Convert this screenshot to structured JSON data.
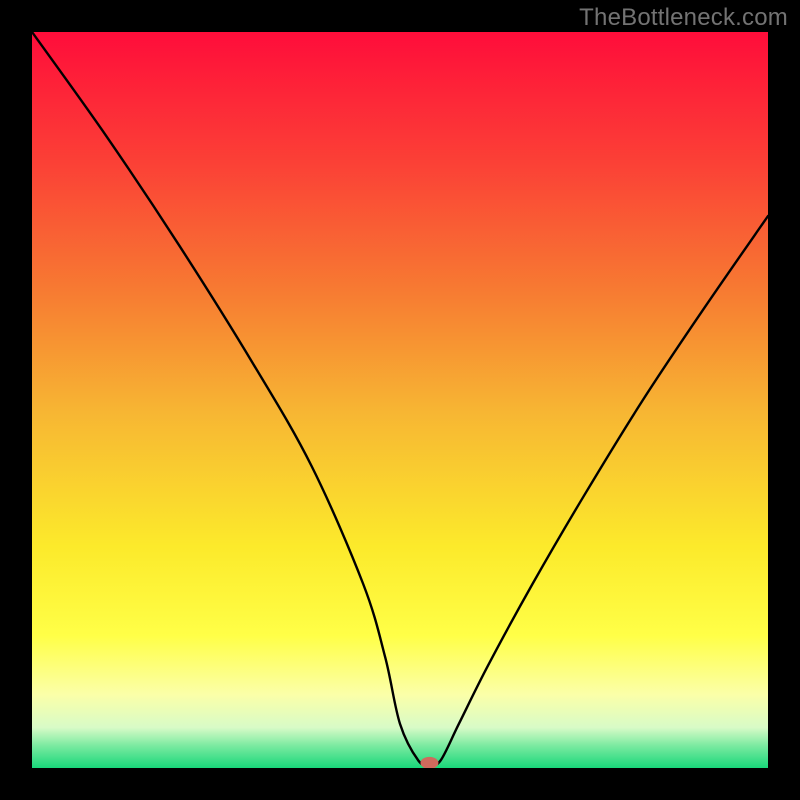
{
  "watermark": "TheBottleneck.com",
  "chart_data": {
    "type": "line",
    "title": "",
    "xlabel": "",
    "ylabel": "",
    "xlim": [
      0,
      100
    ],
    "ylim": [
      0,
      100
    ],
    "background": {
      "type": "vertical-gradient",
      "stops": [
        {
          "pos": 0.0,
          "color": "#ff0d3a"
        },
        {
          "pos": 0.18,
          "color": "#fb4136"
        },
        {
          "pos": 0.35,
          "color": "#f77a32"
        },
        {
          "pos": 0.52,
          "color": "#f7b733"
        },
        {
          "pos": 0.7,
          "color": "#fcea2b"
        },
        {
          "pos": 0.82,
          "color": "#ffff47"
        },
        {
          "pos": 0.9,
          "color": "#fbffa8"
        },
        {
          "pos": 0.945,
          "color": "#d8fbc7"
        },
        {
          "pos": 0.97,
          "color": "#7aeaa0"
        },
        {
          "pos": 1.0,
          "color": "#19d77a"
        }
      ]
    },
    "series": [
      {
        "name": "bottleneck-curve",
        "x": [
          0,
          10,
          20,
          30,
          38,
          45,
          48,
          50,
          52.5,
          54,
          55.5,
          58,
          62,
          68,
          75,
          83,
          91,
          100
        ],
        "y": [
          100,
          86,
          71,
          55,
          41,
          25,
          15,
          6,
          1,
          0.5,
          1,
          6,
          14,
          25,
          37,
          50,
          62,
          75
        ]
      }
    ],
    "marker": {
      "name": "optimal-point",
      "x": 54,
      "y": 0.7,
      "color": "#cf6a5d",
      "rx": 9,
      "ry": 6
    }
  }
}
